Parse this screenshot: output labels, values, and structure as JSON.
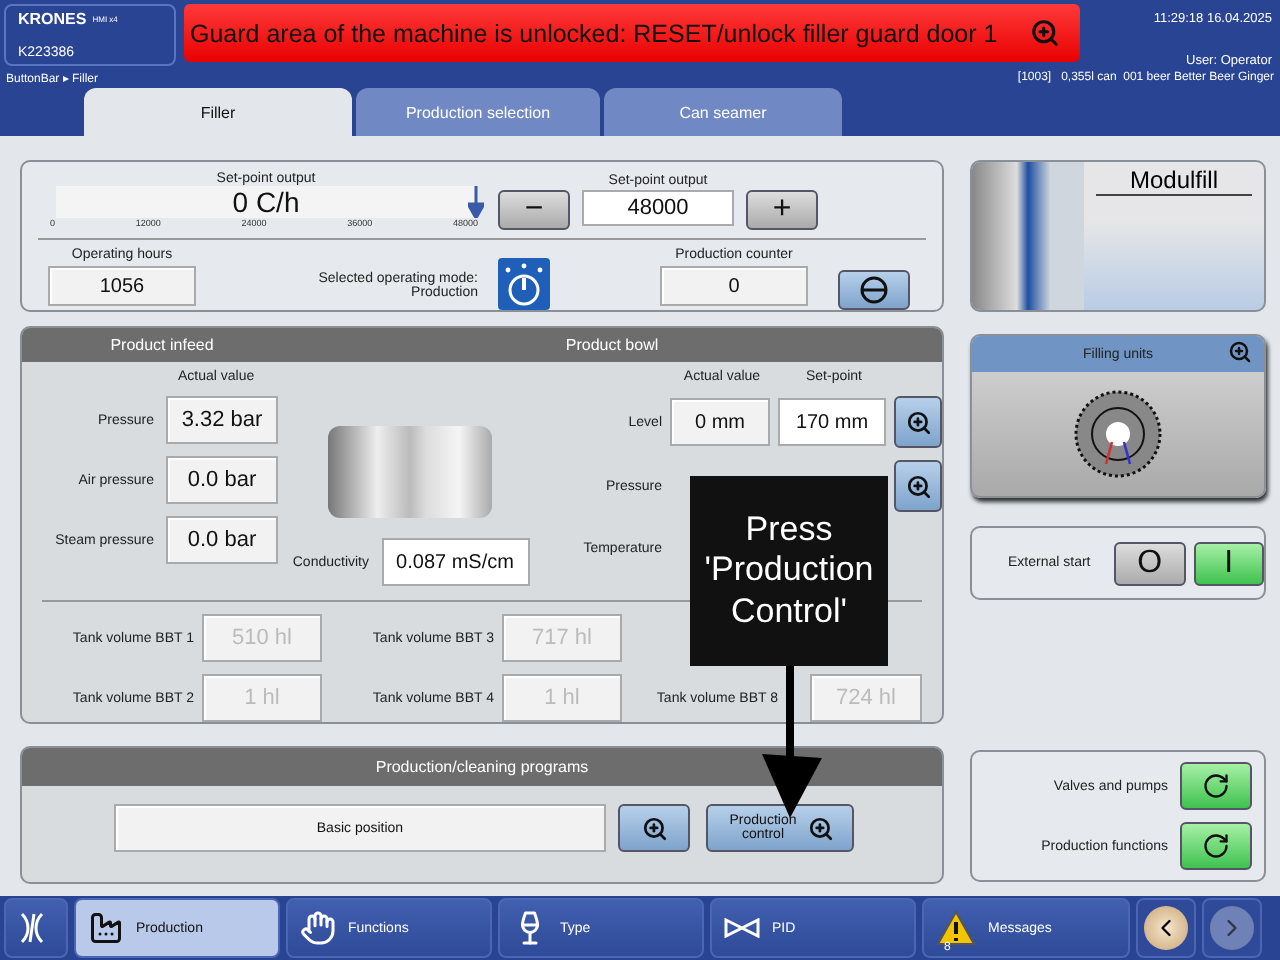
{
  "header": {
    "logo": {
      "brand": "KRONES",
      "sub": "HMI x4",
      "machine_id": "K223386"
    },
    "alarm": {
      "text": "Guard area of the machine is unlocked: RESET/unlock filler guard door 1",
      "active": true
    },
    "datetime": "11:29:18 16.04.2025",
    "user": "User: Operator",
    "breadcrumb": "ButtonBar ▸ Filler",
    "product_info": "[1003]   0,355l can  001 beer Better Beer Ginger"
  },
  "tabs": [
    {
      "label": "Filler",
      "selected": true
    },
    {
      "label": "Production selection",
      "selected": false
    },
    {
      "label": "Can seamer",
      "selected": false
    }
  ],
  "output": {
    "scale": {
      "title": "Set-point output",
      "reading": "0 C/h",
      "level": 0,
      "ticks": [
        "0",
        "12000",
        "24000",
        "36000",
        "48000"
      ],
      "marker": {
        "level": 1
      }
    },
    "setpoint": {
      "label": "Set-point output",
      "value": "48000",
      "minus": "−",
      "plus": "+"
    },
    "operating_hours": {
      "label": "Operating hours",
      "value": "1056"
    },
    "mode": {
      "label": "Selected operating mode:",
      "value": "Production"
    },
    "counter": {
      "label": "Production counter",
      "value": "0"
    }
  },
  "machine": {
    "title": "Modulfill"
  },
  "infeed": {
    "title": "Product infeed",
    "column": "Actual value",
    "rows": [
      {
        "label": "Pressure",
        "value": "3.32 bar"
      },
      {
        "label": "Air pressure",
        "value": "0.0 bar"
      },
      {
        "label": "Steam pressure",
        "value": "0.0 bar"
      }
    ],
    "conductivity": {
      "label": "Conductivity",
      "value": "0.087 mS/cm"
    }
  },
  "bowl": {
    "title": "Product bowl",
    "columns": [
      "Actual value",
      "Set-point"
    ],
    "rows": [
      {
        "label": "Level",
        "actual": "0 mm",
        "setpoint": "170 mm"
      },
      {
        "label": "Pressure"
      },
      {
        "label": "Temperature"
      }
    ]
  },
  "tanks": [
    [
      {
        "label": "Tank volume BBT 1",
        "value": "510 hl",
        "disabled": true
      },
      {
        "label": "Tank volume BBT 3",
        "value": "717 hl",
        "disabled": true
      }
    ],
    [
      {
        "label": "Tank volume BBT 2",
        "value": "1 hl",
        "disabled": true
      },
      {
        "label": "Tank volume BBT 4",
        "value": "1 hl",
        "disabled": true
      },
      {
        "label": "Tank volume BBT 8",
        "value": "724 hl",
        "disabled": true
      }
    ]
  ],
  "programs": {
    "title": "Production/cleaning programs",
    "value": "Basic position",
    "button": "Production control"
  },
  "callout": {
    "text": "Press 'Production Control'"
  },
  "filling_units": {
    "title": "Filling units"
  },
  "external_start": {
    "label": "External start",
    "off_label": "O",
    "on_label": "I",
    "on": true
  },
  "functions": [
    {
      "label": "Valves and pumps"
    },
    {
      "label": "Production functions"
    }
  ],
  "taskbar": [
    {
      "kind": "production",
      "label": "Production",
      "selected": true
    },
    {
      "kind": "functions",
      "label": "Functions",
      "selected": false
    },
    {
      "kind": "type",
      "label": "Type",
      "selected": false
    },
    {
      "kind": "pid",
      "label": "PID",
      "selected": false
    },
    {
      "kind": "messages",
      "label": "Messages",
      "selected": false,
      "badge": "8"
    }
  ]
}
